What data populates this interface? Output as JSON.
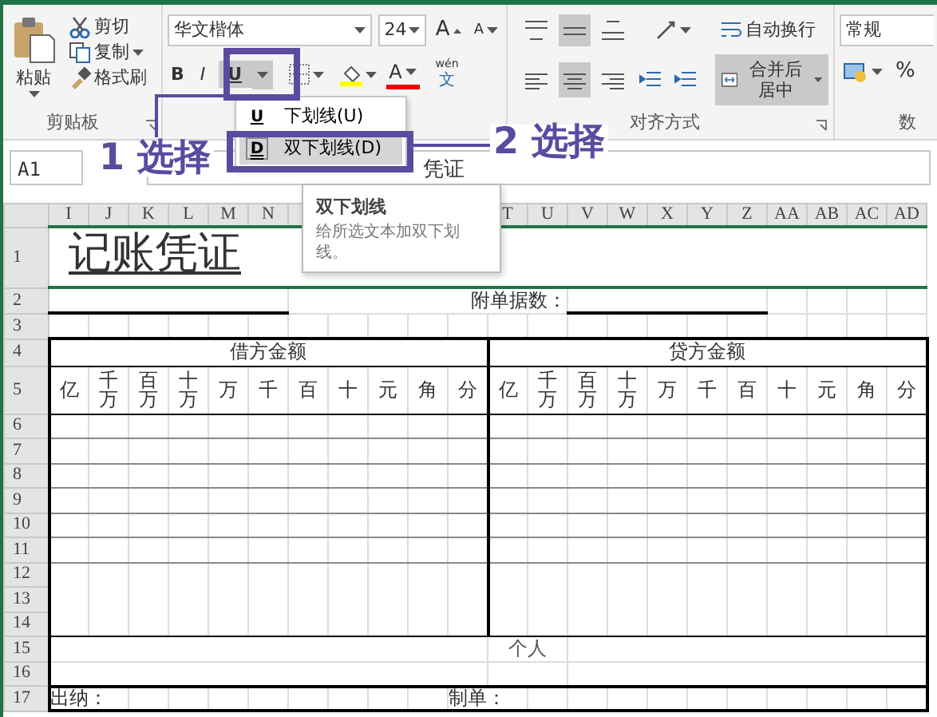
{
  "ribbon": {
    "clipboard": {
      "paste": "粘贴",
      "cut": "剪切",
      "copy": "复制",
      "format_painter": "格式刷",
      "label": "剪贴板"
    },
    "font": {
      "font_name": "华文楷体",
      "font_size": "24",
      "grow": "A",
      "shrink": "A",
      "bold": "B",
      "italic": "I",
      "underline": {
        "text": "U",
        "selected": true
      },
      "font_color": "A",
      "phonetic_ruby": "wén",
      "phonetic_base": "文"
    },
    "alignment": {
      "vertical": [
        {
          "kind": "top",
          "selected": false
        },
        {
          "kind": "middle",
          "selected": true
        },
        {
          "kind": "bottom",
          "selected": false
        }
      ],
      "horizontal": [
        {
          "kind": "left",
          "selected": false
        },
        {
          "kind": "center",
          "selected": true
        },
        {
          "kind": "right",
          "selected": false
        }
      ],
      "wrap_text": "自动换行",
      "merge_center": {
        "text": "合并后居中",
        "selected": true
      },
      "label": "对齐方式"
    },
    "number": {
      "format": "常规",
      "percent": "%",
      "label": "数"
    }
  },
  "formula_bar": {
    "name_box": "A1",
    "value": "凭证"
  },
  "sheet": {
    "columns_left": [
      "I",
      "J",
      "K",
      "L",
      "M",
      "N"
    ],
    "columns_right": [
      "T",
      "U",
      "V",
      "W",
      "X",
      "Y",
      "Z",
      "AA",
      "AB",
      "AC",
      "AD"
    ],
    "rows": [
      "1",
      "2",
      "3",
      "4",
      "5",
      "6",
      "7",
      "8",
      "9",
      "10",
      "11",
      "12",
      "13",
      "14",
      "15",
      "16",
      "17"
    ],
    "title": "记账凭证",
    "attachments_label": "附单据数：",
    "debit_header": "借方金额",
    "credit_header": "贷方金额",
    "debit_units": [
      "亿",
      "千万",
      "百万",
      "十万",
      "万",
      "千",
      "百",
      "十",
      "元",
      "角",
      "分"
    ],
    "credit_units": [
      "亿",
      "千万",
      "百万",
      "十万",
      "万",
      "千",
      "百",
      "十",
      "元",
      "角",
      "分"
    ],
    "note": "个人",
    "cashier_label": "出纳：",
    "preparer_label": "制单："
  },
  "underline_menu": [
    {
      "key": "U",
      "label": "下划线(U)",
      "selected": false
    },
    {
      "key": "D",
      "label": "双下划线(D)",
      "selected": true
    }
  ],
  "tooltip": {
    "title": "双下划线",
    "body": "给所选文本加双下划线。"
  },
  "callouts": [
    {
      "text": "1 选择"
    },
    {
      "text": "2 选择"
    }
  ]
}
